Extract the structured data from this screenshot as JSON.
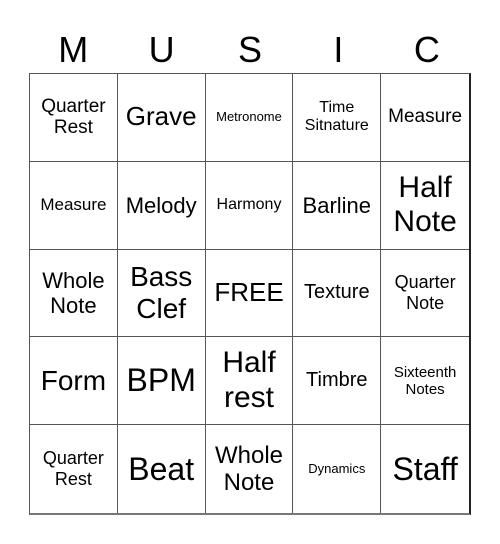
{
  "header": {
    "letters": [
      "M",
      "U",
      "S",
      "I",
      "C"
    ]
  },
  "cells": [
    "Quarter\nRest",
    "Grave",
    "Metronome",
    "Time\nSitnature",
    "Measure",
    "Measure",
    "Melody",
    "Harmony",
    "Barline",
    "Half\nNote",
    "Whole\nNote",
    "Bass\nClef",
    "FREE",
    "Texture",
    "Quarter\nNote",
    "Form",
    "BPM",
    "Half\nrest",
    "Timbre",
    "Sixteenth\nNotes",
    "Quarter\nRest",
    "Beat",
    "Whole\nNote",
    "Dynamics",
    "Staff"
  ]
}
